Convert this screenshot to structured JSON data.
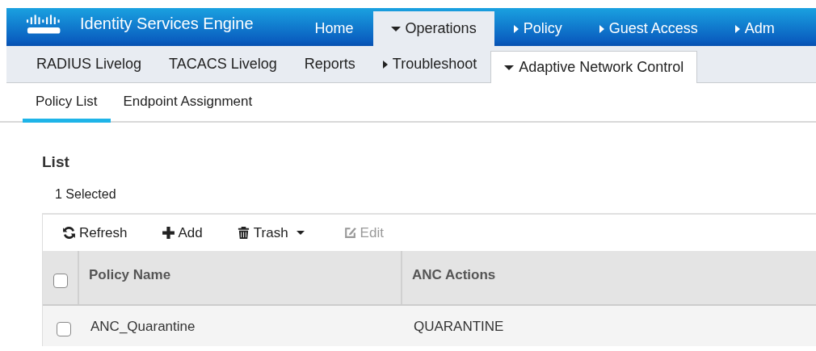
{
  "header": {
    "title": "Identity Services Engine"
  },
  "top_nav": [
    {
      "label": "Home",
      "selected": false
    },
    {
      "label": "Operations",
      "selected": true,
      "expanded": true
    },
    {
      "label": "Policy",
      "selected": false,
      "expanded": false
    },
    {
      "label": "Guest Access",
      "selected": false,
      "expanded": false
    },
    {
      "label": "Adm",
      "selected": false,
      "expanded": false
    }
  ],
  "sub_nav": [
    {
      "label": "RADIUS Livelog",
      "selected": false
    },
    {
      "label": "TACACS Livelog",
      "selected": false
    },
    {
      "label": "Reports",
      "selected": false
    },
    {
      "label": "Troubleshoot",
      "selected": false,
      "expanded": false
    },
    {
      "label": "Adaptive Network Control",
      "selected": true,
      "expanded": true
    }
  ],
  "tabs": [
    {
      "label": "Policy List",
      "selected": true
    },
    {
      "label": "Endpoint Assignment",
      "selected": false
    }
  ],
  "heading": "List",
  "selection_count": "1 Selected",
  "toolbar": [
    {
      "kind": "refresh",
      "label": "Refresh",
      "disabled": false
    },
    {
      "kind": "add",
      "label": "Add",
      "disabled": false
    },
    {
      "kind": "trash",
      "label": "Trash",
      "disabled": false
    },
    {
      "kind": "edit",
      "label": "Edit",
      "disabled": true
    }
  ],
  "table": {
    "header_checked": false,
    "columns": [
      "Policy Name",
      "ANC Actions"
    ],
    "rows": [
      {
        "checked": false,
        "cells": [
          "ANC_Quarantine",
          "QUARANTINE"
        ]
      }
    ]
  }
}
